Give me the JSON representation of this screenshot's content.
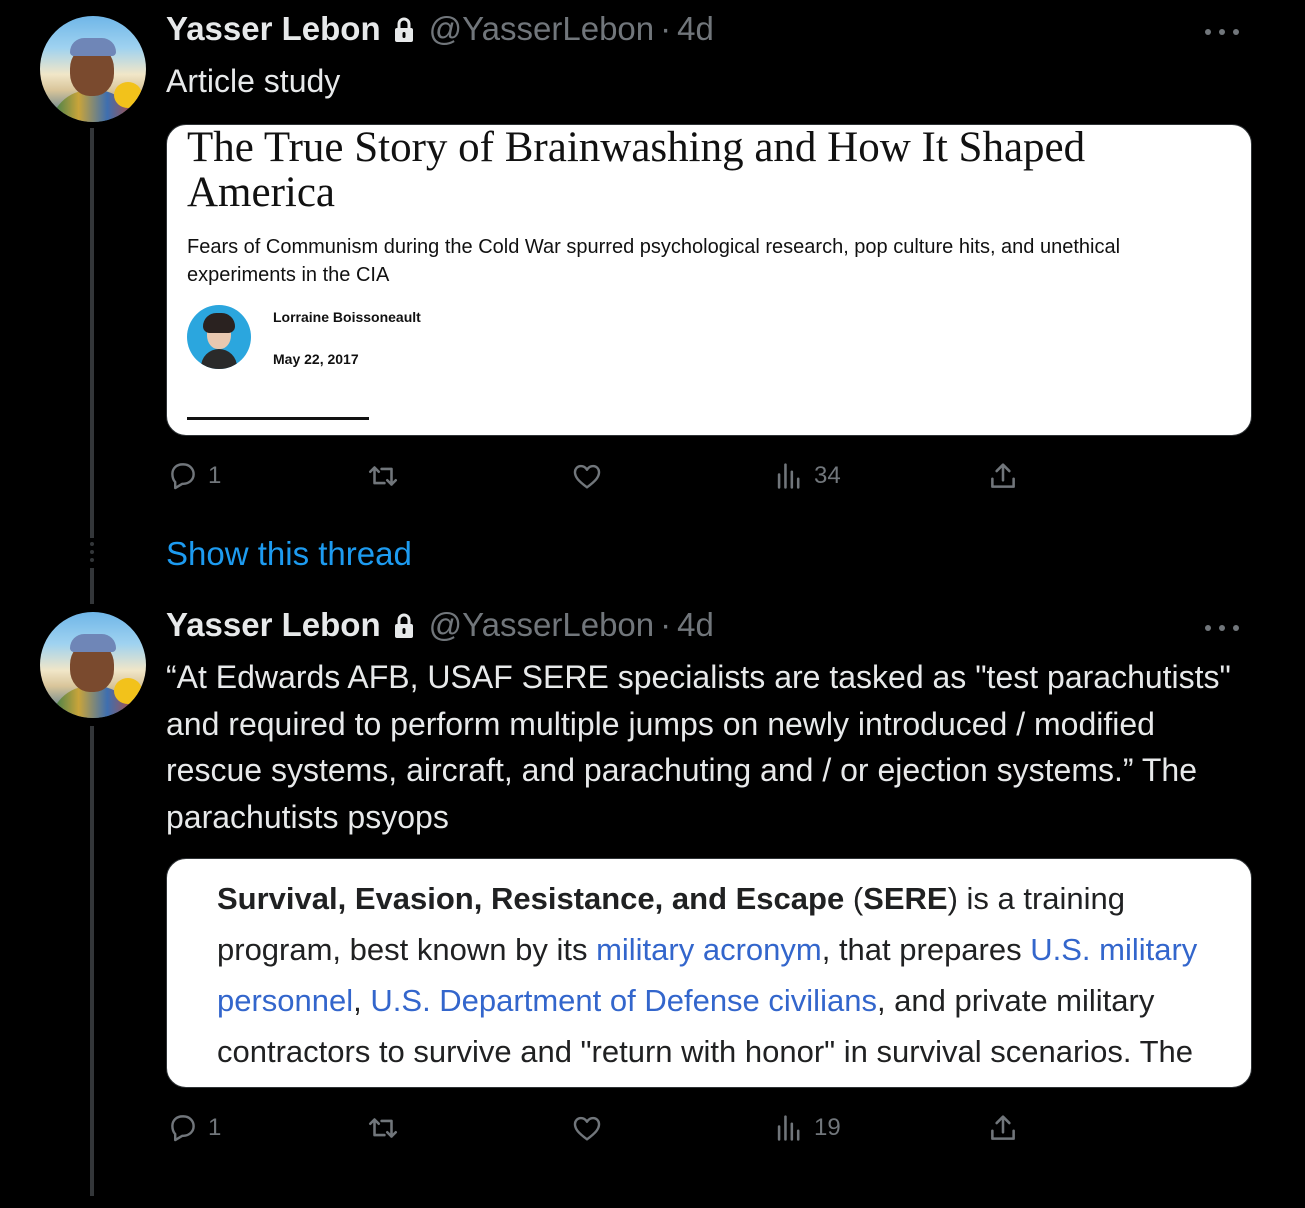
{
  "tweets": [
    {
      "author_name": "Yasser Lebon",
      "handle": "@YasserLebon",
      "separator": "·",
      "time": "4d",
      "text": "Article study",
      "card": {
        "type": "article",
        "title": "The True Story of Brainwashing and How It Shaped America",
        "dek": "Fears of Communism during the Cold War spurred psychological research, pop culture hits, and unethical experiments in the CIA",
        "author": "Lorraine Boissoneault",
        "date": "May 22, 2017"
      },
      "actions": {
        "replies": "1",
        "retweets": "",
        "likes": "",
        "views": "34"
      }
    },
    {
      "author_name": "Yasser Lebon",
      "handle": "@YasserLebon",
      "separator": "·",
      "time": "4d",
      "text": "“At Edwards AFB, USAF SERE specialists are tasked as \"test parachutists\" and required to perform multiple jumps on newly introduced / modified rescue systems, aircraft, and parachuting and / or ejection systems.” The parachutists psyops",
      "card": {
        "type": "wiki",
        "bold": "Survival, Evasion, Resistance, and Escape",
        "paren_open": " (",
        "abbr": "SERE",
        "t1": ") is a training program, best known by its ",
        "link1": "military acronym",
        "t2": ", that prepares ",
        "link2": "U.S. military personnel",
        "t3": ", ",
        "link3": "U.S. Department of Defense civilians",
        "t4": ", and private military contractors to survive and \"return with honor\" in survival scenarios. The"
      },
      "actions": {
        "replies": "1",
        "retweets": "",
        "likes": "",
        "views": "19"
      }
    }
  ],
  "show_thread": "Show this thread",
  "colors": {
    "background": "#000000",
    "primary_text": "#e7e9ea",
    "secondary_text": "#71767b",
    "accent": "#1d9bf0",
    "wiki_link": "#3366cc"
  },
  "icons": [
    "lock-icon",
    "more-icon",
    "reply-icon",
    "retweet-icon",
    "like-icon",
    "views-icon",
    "share-icon"
  ]
}
